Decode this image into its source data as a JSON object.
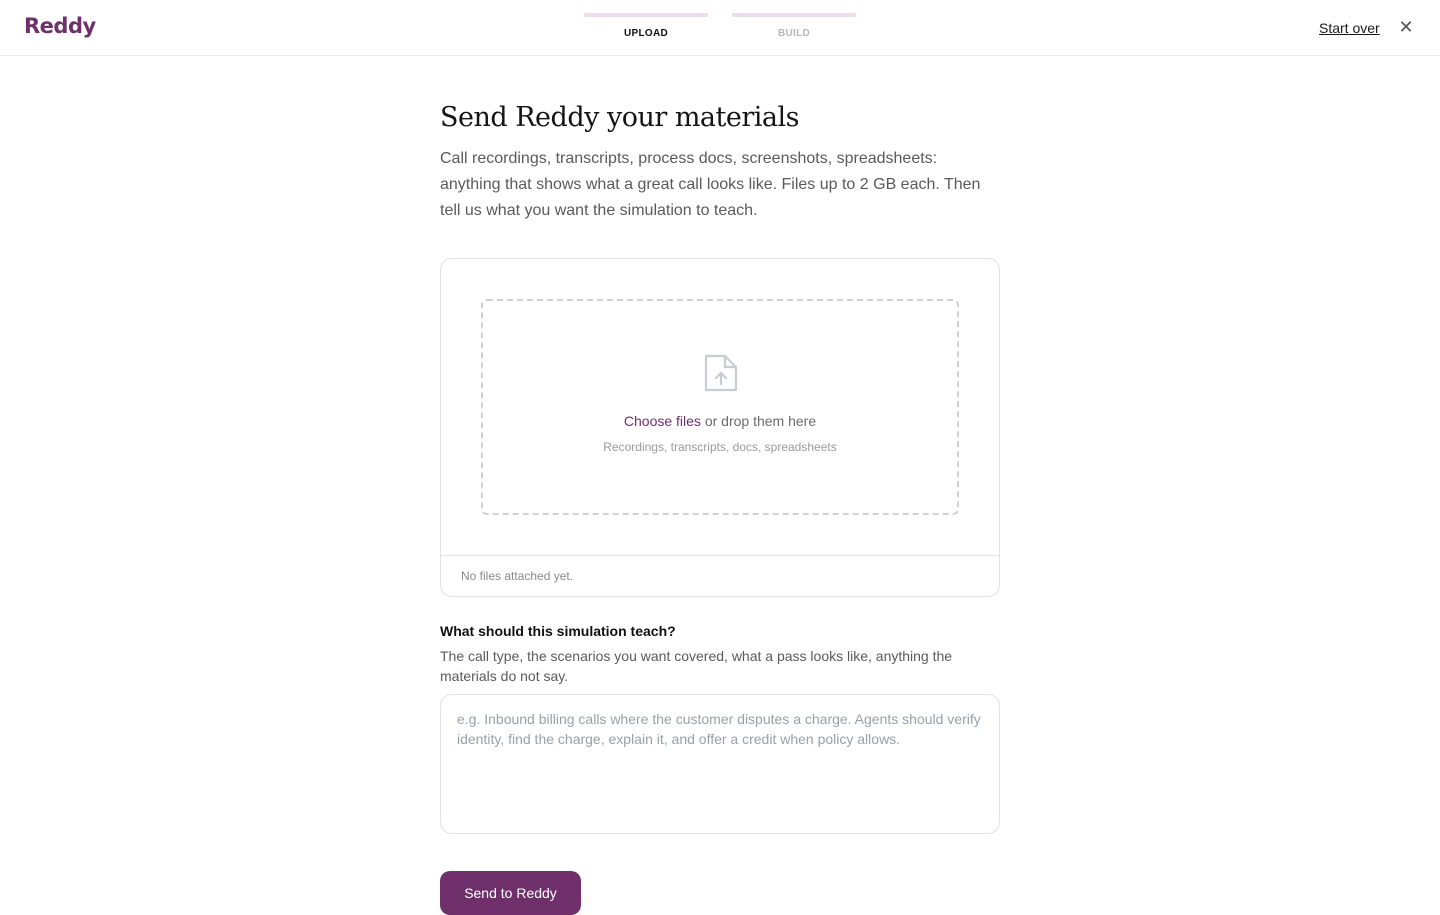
{
  "brand": {
    "name": "Reddy",
    "color": "#6e2f6b",
    "step_bar_color": "#ecdcec"
  },
  "steps": [
    {
      "label": "UPLOAD",
      "active": true,
      "color": "#111111"
    },
    {
      "label": "BUILD",
      "active": false,
      "color": "#b8b8b8"
    }
  ],
  "header": {
    "start_over_label": "Start over",
    "close_icon": "close-icon"
  },
  "main": {
    "title": "Send Reddy your materials",
    "intro": "Call recordings, transcripts, process docs, screenshots, spreadsheets: anything that shows what a great call looks like. Files up to 2 GB each. Then tell us what you want the simulation to teach."
  },
  "upload": {
    "icon": "file-upload-icon",
    "choose_label": "Choose files",
    "drop_suffix": " or drop them here",
    "file_types": "Recordings, transcripts, docs, spreadsheets",
    "status": "No files attached yet."
  },
  "question": {
    "label": "What should this simulation teach?",
    "help": "The call type, the scenarios you want covered, what a pass looks like, anything the materials do not say.",
    "value": "",
    "placeholder": "e.g. Inbound billing calls where the customer disputes a charge. Agents should verify identity, find the charge, explain it, and offer a credit when policy allows."
  },
  "actions": {
    "send_label": "Send to Reddy",
    "send_color": "#6e2f6b"
  }
}
